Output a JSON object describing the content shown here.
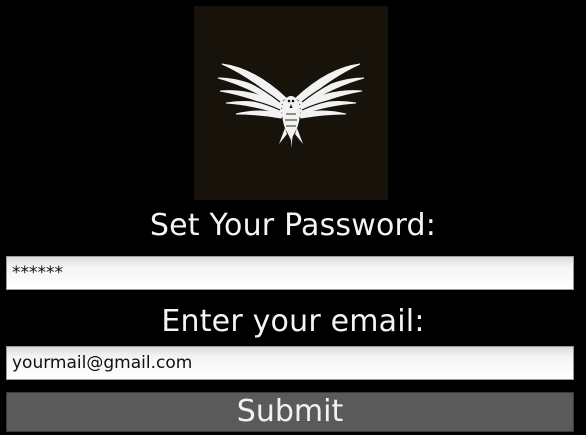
{
  "logo": {
    "icon": "eagle-icon",
    "background": "#17130b"
  },
  "password": {
    "label": "Set Your Password:",
    "value": "******"
  },
  "email": {
    "label": "Enter your email:",
    "value": "yourmail@gmail.com"
  },
  "submit": {
    "label": "Submit"
  },
  "colors": {
    "page_background": "#000000",
    "button_background": "#5a5a5a",
    "text": "#ffffff"
  }
}
